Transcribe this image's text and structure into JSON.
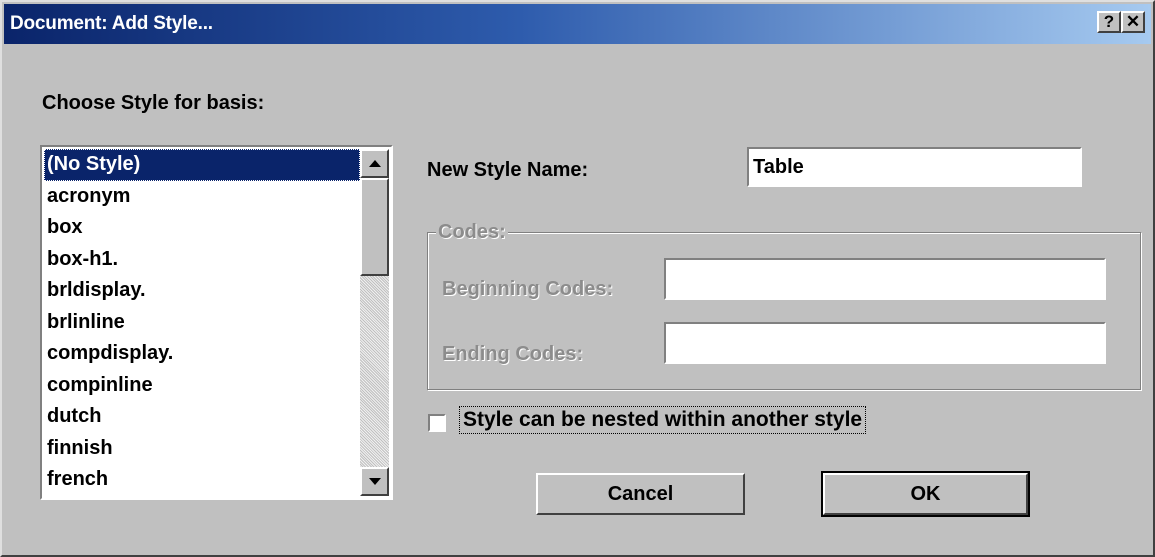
{
  "window": {
    "title": "Document: Add Style...",
    "help_button": "?",
    "close_button": "✕"
  },
  "basis": {
    "label": "Choose Style for basis:",
    "items": [
      "(No Style)",
      "acronym",
      "box",
      "box-h1.",
      "brldisplay.",
      "brlinline",
      "compdisplay.",
      "compinline",
      "dutch",
      "finnish",
      "french"
    ],
    "selected": "(No Style)"
  },
  "new_style": {
    "label": "New Style Name:",
    "value": "Table"
  },
  "codes": {
    "group_label": "Codes:",
    "beginning_label": "Beginning Codes:",
    "beginning_value": "",
    "ending_label": "Ending Codes:",
    "ending_value": ""
  },
  "nested": {
    "label": "Style can be nested within another style",
    "checked": false
  },
  "buttons": {
    "cancel": "Cancel",
    "ok": "OK"
  }
}
